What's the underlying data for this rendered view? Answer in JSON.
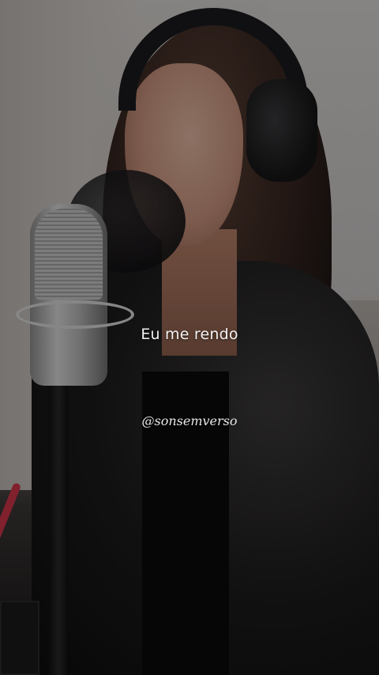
{
  "video": {
    "lyric_line": "Eu me rendo",
    "watermark_handle": "@sonsemverso"
  }
}
